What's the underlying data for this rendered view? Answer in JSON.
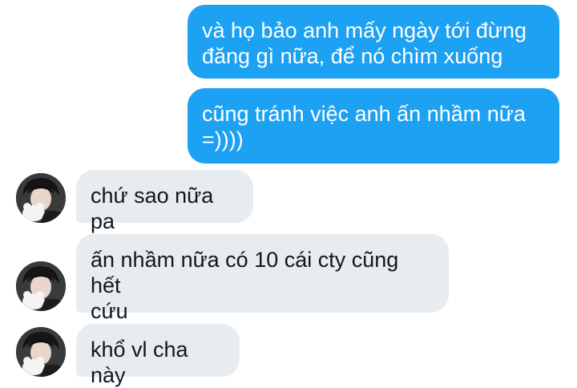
{
  "conversation": {
    "sent_messages": [
      {
        "lines": [
          "và họ bảo anh mấy ngày tới đừng",
          "đăng gì nữa, để nó chìm xuống"
        ]
      },
      {
        "lines": [
          "cũng tránh việc anh ấn nhầm nữa",
          "=))))"
        ]
      }
    ],
    "received_messages": [
      {
        "lines": [
          "chứ sao nữa pa"
        ]
      },
      {
        "lines": [
          "ấn nhầm nữa có 10 cái cty cũng hết",
          "cứu"
        ]
      },
      {
        "lines": [
          "khổ vl cha này"
        ]
      }
    ],
    "avatar_icon": "user-avatar-photo",
    "colors": {
      "sent_bubble": "#1da1f2",
      "received_bubble": "#e6ecf0",
      "sent_text": "#ffffff",
      "received_text": "#14171a"
    }
  }
}
